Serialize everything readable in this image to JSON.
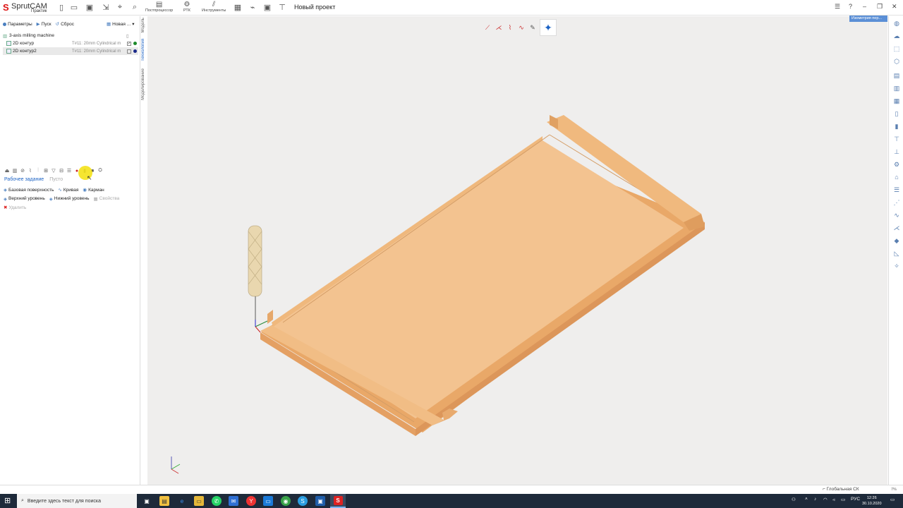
{
  "app": {
    "logo_name": "SprutCAM",
    "logo_sub": "Практик",
    "project_title": "Новый проект"
  },
  "toolbar": {
    "postprocessor_label": "Постпроцессор",
    "rtk_label": "РТК",
    "tools_label": "Инструменты"
  },
  "left_panel": {
    "params_label": "Параметры",
    "run_label": "Пуск",
    "reset_label": "Сброс",
    "new_label": "Новая ..."
  },
  "side_tabs": [
    "Модель",
    "Технология",
    "Моделирование"
  ],
  "tree": {
    "machine": "3-axis milling machine",
    "ops": [
      {
        "name": "2D контур",
        "tool": "T#11: 20mm Cylindrical m",
        "checked": true,
        "color": "#1d8a2a",
        "selected": false
      },
      {
        "name": "2D контур2",
        "tool": "T#11: 20mm Cylindrical m",
        "checked": false,
        "color": "#1b2a8a",
        "selected": true
      }
    ]
  },
  "ops_panel": {
    "tab_job": "Рабочее задание",
    "tab_empty": "Пусто",
    "base_surface": "Базовая поверхность",
    "curve": "Кривая",
    "pocket": "Карман",
    "top_level": "Верхний уровень",
    "bottom_level": "Нижний уровень",
    "properties": "Свойства",
    "delete": "Удалить"
  },
  "viewport": {
    "view_dropdown": "Изометрия пер..."
  },
  "status": {
    "cs_label": "Глобальная СК",
    "percent": "7%"
  },
  "taskbar": {
    "search_placeholder": "Введите здесь текст для поиска",
    "lang": "РУС",
    "time": "12:26",
    "date": "30.10.2020"
  }
}
